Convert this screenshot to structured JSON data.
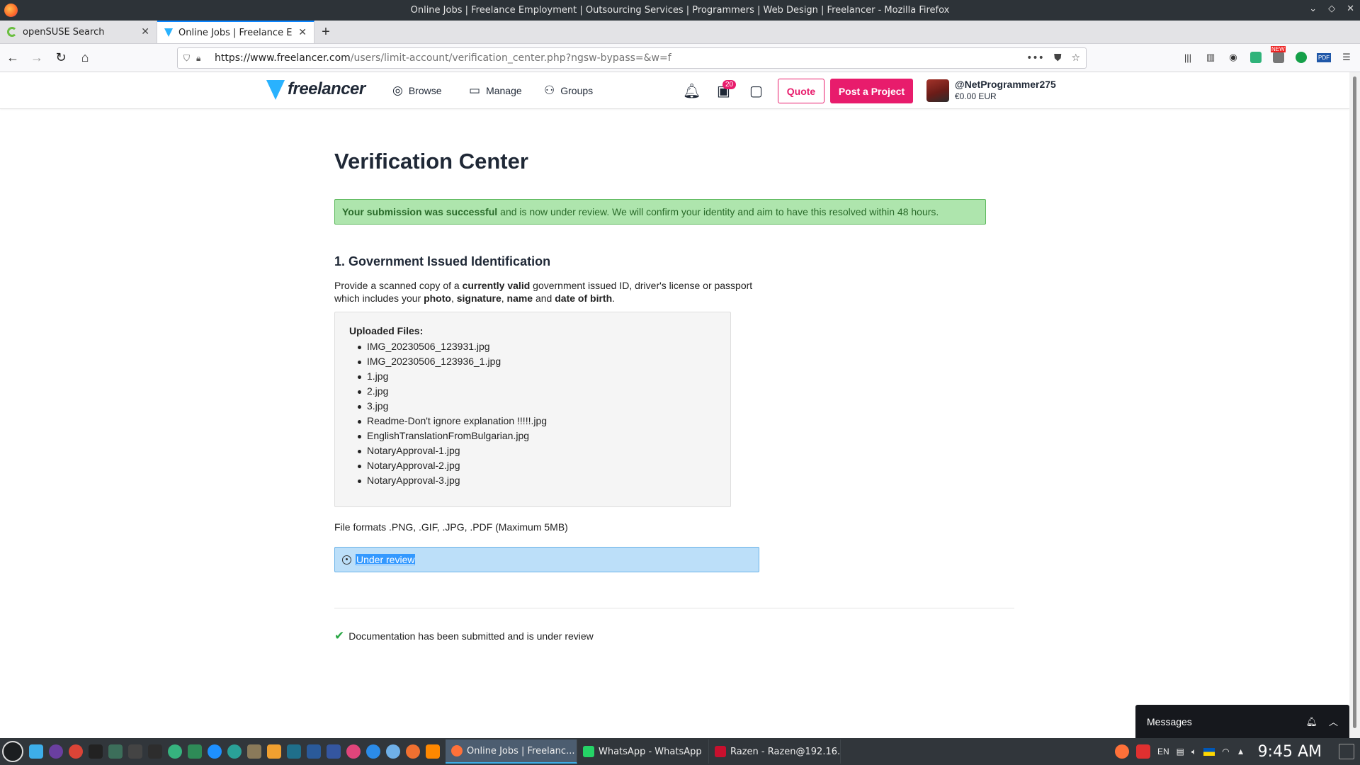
{
  "window": {
    "title": "Online Jobs | Freelance Employment | Outsourcing Services | Programmers | Web Design | Freelancer - Mozilla Firefox"
  },
  "tabs": [
    {
      "title": "openSUSE Search",
      "active": false
    },
    {
      "title": "Online Jobs | Freelance Em",
      "active": true
    }
  ],
  "navbar": {
    "url_host": "https://www.freelancer.com",
    "url_path": "/users/limit-account/verification_center.php?ngsw-bypass=&w=f",
    "ext_new_badge": "NEW",
    "ext_pdf_label": "PDF"
  },
  "header": {
    "logo_text": "freelancer",
    "nav": [
      {
        "label": "Browse",
        "icon": "compass-icon"
      },
      {
        "label": "Manage",
        "icon": "briefcase-icon"
      },
      {
        "label": "Groups",
        "icon": "people-icon"
      }
    ],
    "projects_badge": "20",
    "quote_label": "Quote",
    "post_label": "Post a Project",
    "username": "@NetProgrammer275",
    "balance": "€0.00 EUR"
  },
  "page": {
    "title": "Verification Center",
    "alert_bold": "Your submission was successful",
    "alert_rest": "and is now under review. We will confirm your identity and aim to have this resolved within 48 hours.",
    "section_title": "1. Government Issued Identification",
    "desc_parts": {
      "p1": "Provide a scanned copy of a ",
      "b1": "currently valid",
      "p2": " government issued ID, driver's license or passport which includes your ",
      "b2": "photo",
      "p3": ", ",
      "b3": "signature",
      "p4": ", ",
      "b4": "name",
      "p5": " and ",
      "b5": "date of birth",
      "p6": "."
    },
    "files_heading": "Uploaded Files:",
    "files": [
      "IMG_20230506_123931.jpg",
      "IMG_20230506_123936_1.jpg",
      "1.jpg",
      "2.jpg",
      "3.jpg",
      "Readme-Don't ignore explanation !!!!!.jpg",
      "EnglishTranslationFromBulgarian.jpg",
      "NotaryApproval-1.jpg",
      "NotaryApproval-2.jpg",
      "NotaryApproval-3.jpg"
    ],
    "formats": "File formats .PNG, .GIF, .JPG, .PDF (Maximum 5MB)",
    "status": "Under review",
    "done_text": "Documentation has been submitted and is under review"
  },
  "messages": {
    "title": "Messages"
  },
  "taskbar": {
    "tasks": [
      {
        "label": "Online Jobs | Freelanc...",
        "active": true,
        "color": "#ff7139"
      },
      {
        "label": "WhatsApp - WhatsApp",
        "active": false,
        "color": "#25d366"
      },
      {
        "label": "Razen - Razen@192.16...",
        "active": false,
        "color": "#c8102e"
      }
    ],
    "lang": "EN",
    "time": "9:45 AM"
  },
  "colors": {
    "brand_pink": "#e81c6c",
    "brand_blue": "#29b2fe",
    "success_bg": "#aee5ad",
    "info_bg": "#bcdff9"
  }
}
